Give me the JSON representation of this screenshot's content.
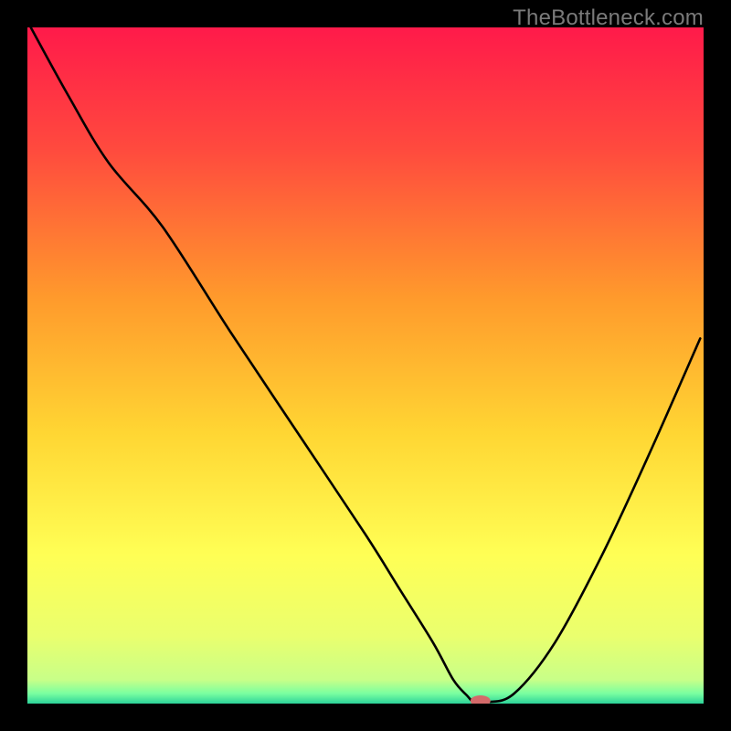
{
  "watermark": "TheBottleneck.com",
  "chart_data": {
    "type": "line",
    "title": "",
    "xlabel": "",
    "ylabel": "",
    "xlim": [
      0,
      100
    ],
    "ylim": [
      0,
      100
    ],
    "grid": false,
    "legend": false,
    "background_gradient_stops": [
      {
        "pct": 0.0,
        "color": "#ff1a4a"
      },
      {
        "pct": 0.18,
        "color": "#ff4a3e"
      },
      {
        "pct": 0.4,
        "color": "#ff9a2c"
      },
      {
        "pct": 0.6,
        "color": "#ffd633"
      },
      {
        "pct": 0.78,
        "color": "#ffff55"
      },
      {
        "pct": 0.9,
        "color": "#eaff6e"
      },
      {
        "pct": 0.965,
        "color": "#c8ff88"
      },
      {
        "pct": 0.985,
        "color": "#7affa0"
      },
      {
        "pct": 1.0,
        "color": "#2cd39a"
      }
    ],
    "series": [
      {
        "name": "bottleneck_curve",
        "x": [
          0.5,
          6,
          12,
          20,
          30,
          40,
          50,
          55,
          60,
          63,
          65,
          66,
          68,
          72,
          78,
          85,
          92,
          99.5
        ],
        "y": [
          100,
          90,
          80,
          70.5,
          55,
          40,
          25,
          17,
          9,
          3.5,
          1.2,
          0.3,
          0.2,
          1.5,
          9,
          22,
          37,
          54
        ]
      }
    ],
    "marker": {
      "name": "optimal_point",
      "x": 67,
      "y": 0.4,
      "color": "#d46a6a",
      "rx": 11,
      "ry": 6
    }
  }
}
